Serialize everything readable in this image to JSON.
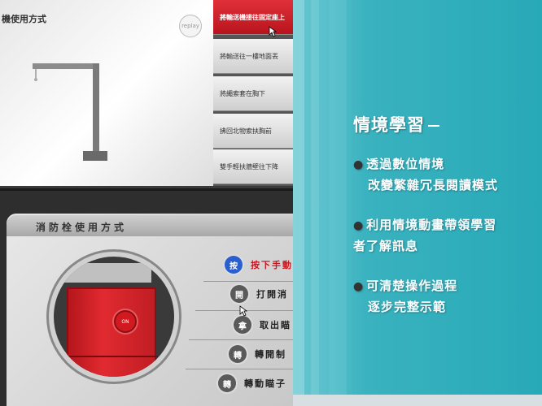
{
  "top_screen": {
    "title": "機使用方式",
    "replay_label": "replay",
    "menu": [
      {
        "label": "將輸送機接往固定座上",
        "active": true
      },
      {
        "label": "將輸送往一樓地面丟",
        "active": false
      },
      {
        "label": "將繩索套在胸下",
        "active": false
      },
      {
        "label": "拂回北物索扶胸前",
        "active": false
      },
      {
        "label": "雙手輕扶牆壁往下降",
        "active": false
      }
    ]
  },
  "bottom_screen": {
    "title": "消防栓使用方式",
    "alarm_label": "ON",
    "steps": [
      {
        "icon": "按",
        "label": "按下手動",
        "active": true
      },
      {
        "icon": "開",
        "label": "打開消",
        "active": false
      },
      {
        "icon": "拿",
        "label": "取出瞄",
        "active": false
      },
      {
        "icon": "轉",
        "label": "轉開制",
        "active": false
      },
      {
        "icon": "轉",
        "label": "轉動瞄子",
        "active": false
      }
    ]
  },
  "right_panel": {
    "heading": "情境學習",
    "bullets": [
      {
        "line1": "透過數位情境",
        "line2": "改變繁雜冗長閱讀模式"
      },
      {
        "line1": "利用情境動畫帶領學習",
        "line2": "者了解訊息"
      },
      {
        "line1": "可清楚操作過程",
        "line2": "逐步完整示範"
      }
    ]
  },
  "colors": {
    "teal": "#28a9b7",
    "accent_red": "#c81820",
    "step_active_blue": "#2a5fd0"
  }
}
